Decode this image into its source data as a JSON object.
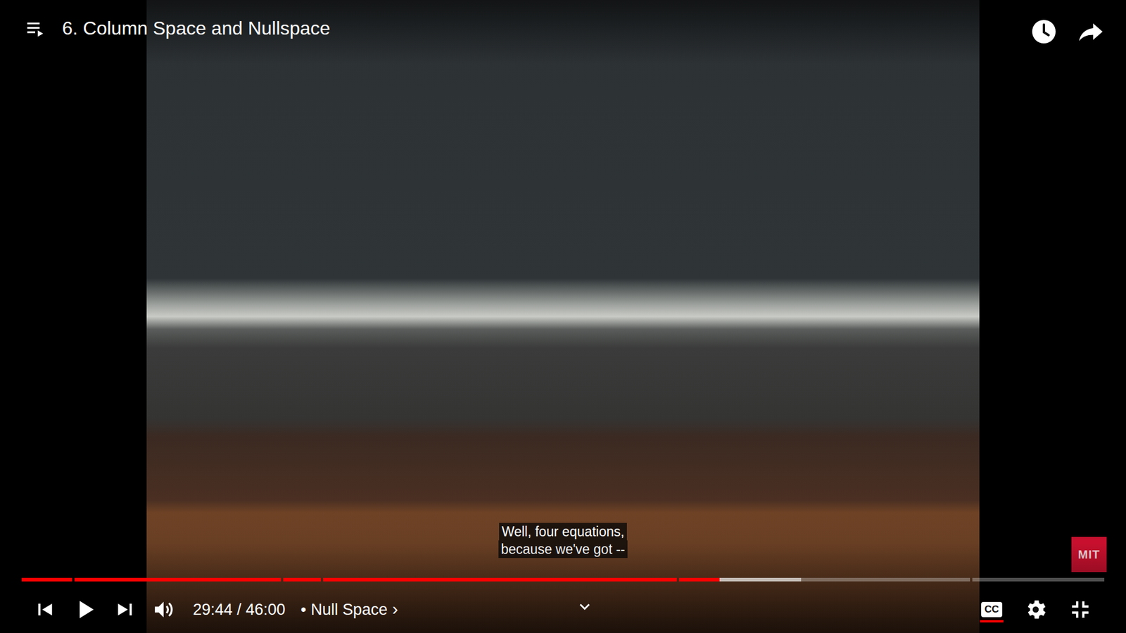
{
  "player": {
    "title": "6. Column Space and Nullspace",
    "playing": false,
    "captions_on": true
  },
  "caption": {
    "lines": [
      "Well, four equations,",
      "because we've got --"
    ]
  },
  "watermark": {
    "label": "MIT"
  },
  "time": {
    "current": "29:44",
    "separator": "/",
    "duration": "46:00"
  },
  "chapter": {
    "bullet": "•",
    "title": "Null Space",
    "arrow": "›"
  },
  "progress": {
    "level": 0.643,
    "buffered": 0.719,
    "chapters": [
      {
        "length": 0.047
      },
      {
        "length": 0.193
      },
      {
        "length": 0.035
      },
      {
        "length": 0.33
      },
      {
        "length": 0.272
      },
      {
        "length": 0.123
      }
    ]
  },
  "cc_button": {
    "label": "CC"
  }
}
